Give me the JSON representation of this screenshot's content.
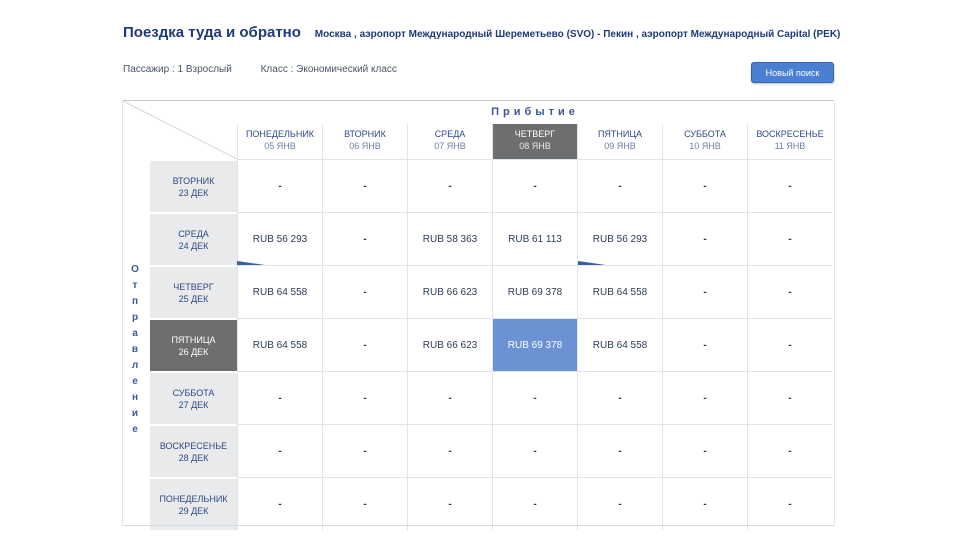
{
  "header": {
    "title": "Поездка туда и обратно",
    "route": "Москва , аэропорт Международный Шереметьево (SVO) - Пекин , аэропорт Международный Capital (PEK)"
  },
  "subline": {
    "passengers": "Пассажир : 1 Взрослый",
    "class": "Класс : Экономический класс"
  },
  "buttons": {
    "new_search": "Новый поиск"
  },
  "arrival_label": "Прибытие",
  "departure_label_letters": [
    "О",
    "т",
    "п",
    "р",
    "а",
    "в",
    "л",
    "е",
    "н",
    "и",
    "е"
  ],
  "columns": [
    {
      "day": "ПОНЕДЕЛЬНИК",
      "date": "05 ЯНВ"
    },
    {
      "day": "ВТОРНИК",
      "date": "06 ЯНВ"
    },
    {
      "day": "СРЕДА",
      "date": "07 ЯНВ"
    },
    {
      "day": "ЧЕТВЕРГ",
      "date": "08 ЯНВ",
      "selected": true
    },
    {
      "day": "ПЯТНИЦА",
      "date": "09 ЯНВ"
    },
    {
      "day": "СУББОТА",
      "date": "10 ЯНВ"
    },
    {
      "day": "ВОСКРЕСЕНЬЕ",
      "date": "11 ЯНВ"
    }
  ],
  "rows": [
    {
      "day": "ВТОРНИК",
      "date": "23 ДЕК",
      "cells": [
        "-",
        "-",
        "-",
        "-",
        "-",
        "-",
        "-"
      ]
    },
    {
      "day": "СРЕДА",
      "date": "24 ДЕК",
      "cells": [
        "RUB 56 293",
        "-",
        "RUB 58 363",
        "RUB 61 113",
        "RUB 56 293",
        "-",
        "-"
      ]
    },
    {
      "day": "ЧЕТВЕРГ",
      "date": "25 ДЕК",
      "cells": [
        "RUB 64 558",
        "-",
        "RUB 66 623",
        "RUB 69 378",
        "RUB 64 558",
        "-",
        "-"
      ]
    },
    {
      "day": "ПЯТНИЦА",
      "date": "26 ДЕК",
      "selected": true,
      "cells": [
        "RUB 64 558",
        "-",
        "RUB 66 623",
        "RUB 69 378",
        "RUB 64 558",
        "-",
        "-"
      ]
    },
    {
      "day": "СУББОТА",
      "date": "27 ДЕК",
      "cells": [
        "-",
        "-",
        "-",
        "-",
        "-",
        "-",
        "-"
      ]
    },
    {
      "day": "ВОСКРЕСЕНЬЕ",
      "date": "28 ДЕК",
      "cells": [
        "-",
        "-",
        "-",
        "-",
        "-",
        "-",
        "-"
      ]
    },
    {
      "day": "ПОНЕДЕЛЬНИК",
      "date": "29 ДЕК",
      "cells": [
        "-",
        "-",
        "-",
        "-",
        "-",
        "-",
        "-"
      ]
    }
  ],
  "selected_cell": {
    "row": 3,
    "col": 3
  },
  "colors": {
    "accent": "#4a7fd1",
    "selected_cell": "#6b92d3",
    "selected_header": "#6d6e70",
    "title": "#1f3a78"
  }
}
